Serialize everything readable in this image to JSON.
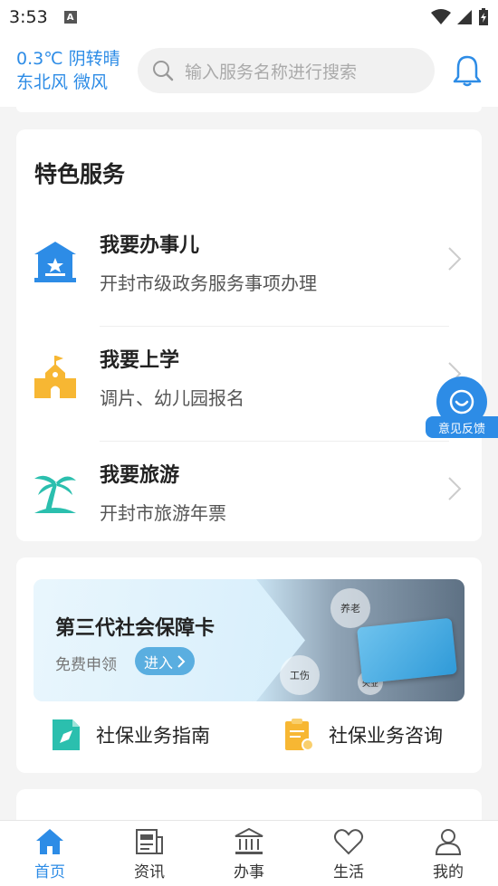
{
  "status_bar": {
    "time": "3:53",
    "notif_glyph": "A"
  },
  "header": {
    "weather_line1": "0.3℃ 阴转晴",
    "weather_line2": "东北风 微风",
    "search_placeholder": "输入服务名称进行搜索"
  },
  "featured": {
    "title": "特色服务",
    "items": [
      {
        "name": "我要办事儿",
        "desc": "开封市级政务服务事项办理",
        "icon": "government-building-icon"
      },
      {
        "name": "我要上学",
        "desc": "调片、幼儿园报名",
        "icon": "school-icon"
      },
      {
        "name": "我要旅游",
        "desc": "开封市旅游年票",
        "icon": "palm-tree-icon"
      }
    ]
  },
  "social_security": {
    "banner_title": "第三代社会保障卡",
    "banner_sub": "免费申领",
    "banner_button": "进入",
    "bubbles": [
      "养老",
      "工伤",
      "失业"
    ],
    "links": [
      {
        "label": "社保业务指南",
        "icon": "guide-document-icon"
      },
      {
        "label": "社保业务咨询",
        "icon": "consult-clipboard-icon"
      }
    ]
  },
  "feedback": {
    "label": "意见反馈"
  },
  "tabs": [
    {
      "label": "首页",
      "icon": "home-icon",
      "active": true
    },
    {
      "label": "资讯",
      "icon": "news-icon",
      "active": false
    },
    {
      "label": "办事",
      "icon": "hall-icon",
      "active": false
    },
    {
      "label": "生活",
      "icon": "heart-icon",
      "active": false
    },
    {
      "label": "我的",
      "icon": "person-icon",
      "active": false
    }
  ],
  "colors": {
    "accent": "#2d8ce6",
    "background": "#f4f4f4"
  }
}
